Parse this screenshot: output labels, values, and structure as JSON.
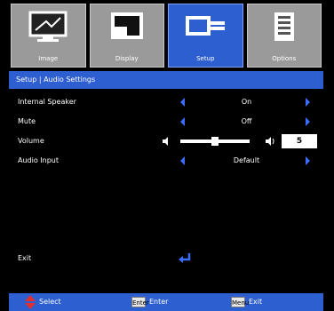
{
  "tabs": [
    {
      "label": "Image"
    },
    {
      "label": "Display"
    },
    {
      "label": "Setup"
    },
    {
      "label": "Options"
    }
  ],
  "breadcrumb": "Setup | Audio Settings",
  "rows": [
    {
      "label": "Internal Speaker",
      "value": "On"
    },
    {
      "label": "Mute",
      "value": "Off"
    },
    {
      "label": "Volume",
      "value": "5"
    },
    {
      "label": "Audio Input",
      "value": "Default"
    }
  ],
  "volume_level": 0.5,
  "exit_label": "Exit",
  "footer": {
    "select_label": "Select",
    "enter_key": "Enter",
    "enter_label": "Enter",
    "menu_key": "Menu",
    "menu_label": "Exit"
  },
  "colors": {
    "accent": "#2e5fd0",
    "arrow": "#3b6cff",
    "tab_inactive": "#9a9a9a"
  }
}
